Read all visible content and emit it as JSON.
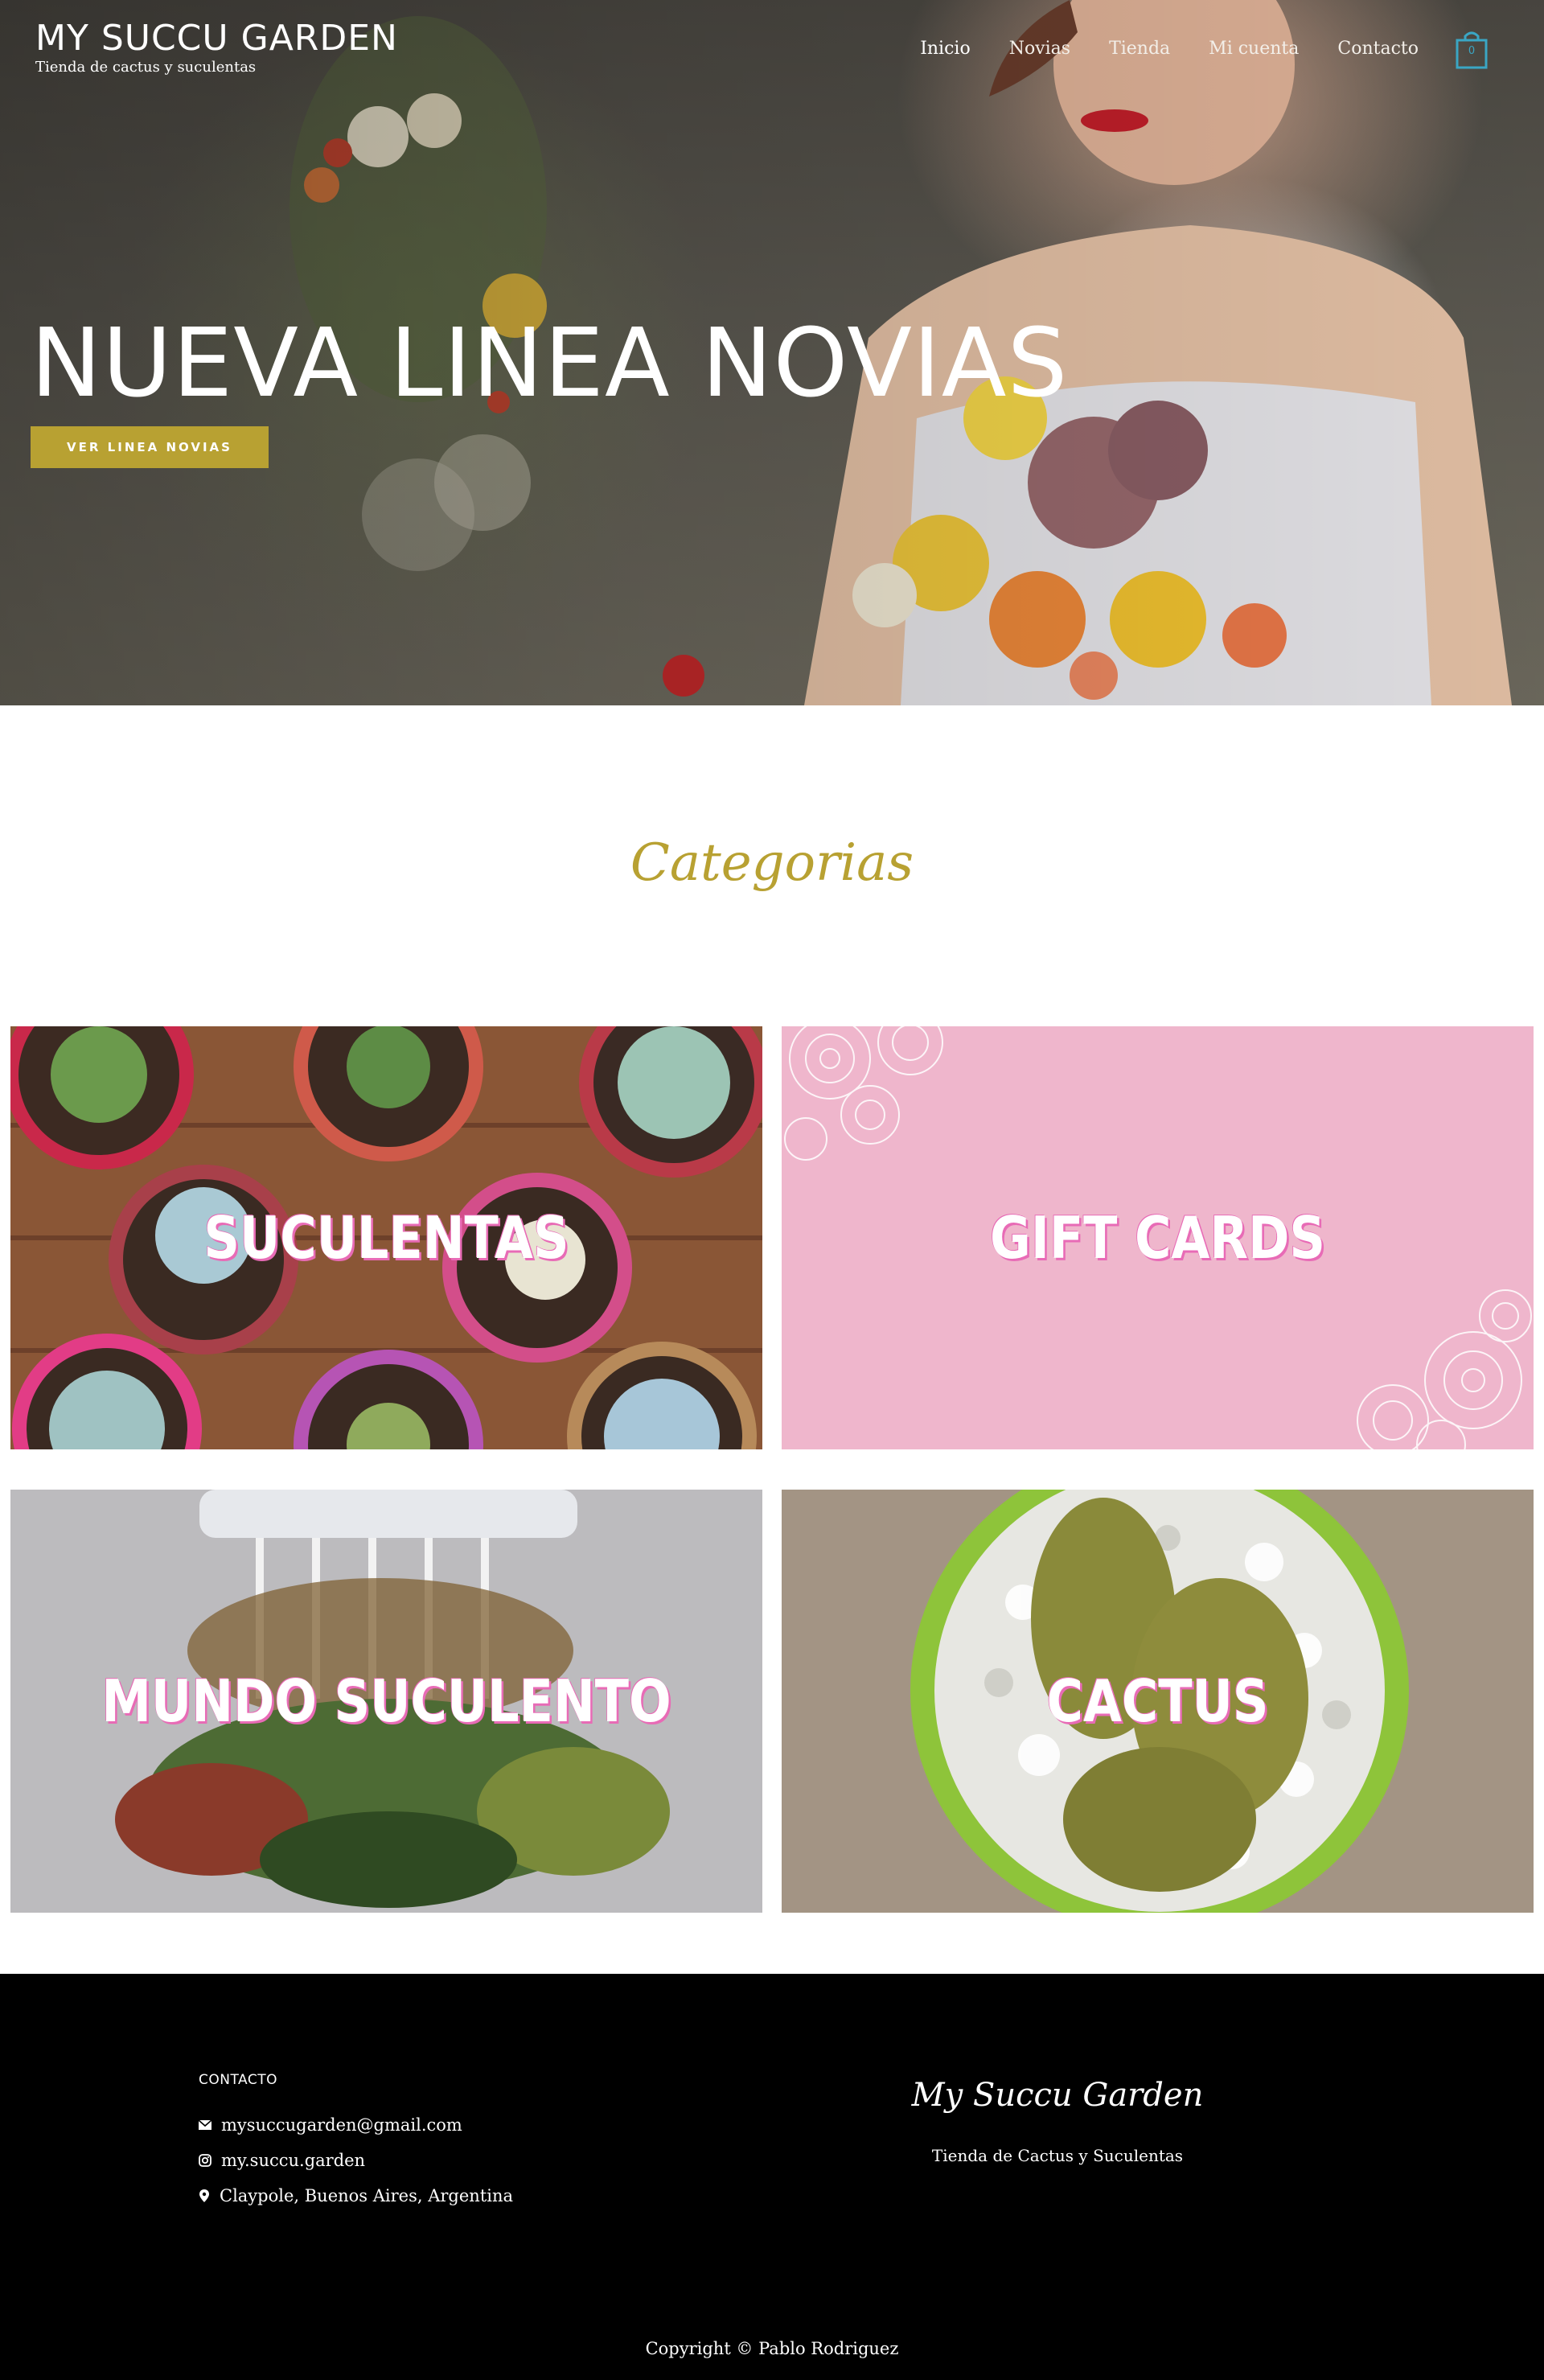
{
  "header": {
    "site_title": "MY SUCCU GARDEN",
    "tagline": "Tienda de cactus y suculentas",
    "nav": [
      {
        "label": "Inicio"
      },
      {
        "label": "Novias"
      },
      {
        "label": "Tienda"
      },
      {
        "label": "Mi cuenta"
      },
      {
        "label": "Contacto"
      }
    ],
    "cart_count": "0",
    "cart_icon": "shopping-bag-icon"
  },
  "hero": {
    "headline": "NUEVA LINEA NOVIAS",
    "button_label": "VER LINEA NOVIAS"
  },
  "categories": {
    "title": "Categorias",
    "items": [
      {
        "label": "SUCULENTAS"
      },
      {
        "label": "GIFT CARDS"
      },
      {
        "label": "MUNDO SUCULENTO"
      },
      {
        "label": "CACTUS"
      }
    ]
  },
  "footer": {
    "contact_heading": "CONTACTO",
    "email": "mysuccugarden@gmail.com",
    "instagram": "my.succu.garden",
    "location": "Claypole, Buenos Aires, Argentina",
    "brand": "My Succu Garden",
    "brand_tagline": "Tienda de Cactus y Suculentas",
    "copyright": "Copyright © Pablo Rodriguez"
  },
  "colors": {
    "accent_gold": "#b8a132",
    "cart_blue": "#3aa6c4",
    "tile_text_shadow": "#e86bb6",
    "footer_bg": "#000000"
  }
}
